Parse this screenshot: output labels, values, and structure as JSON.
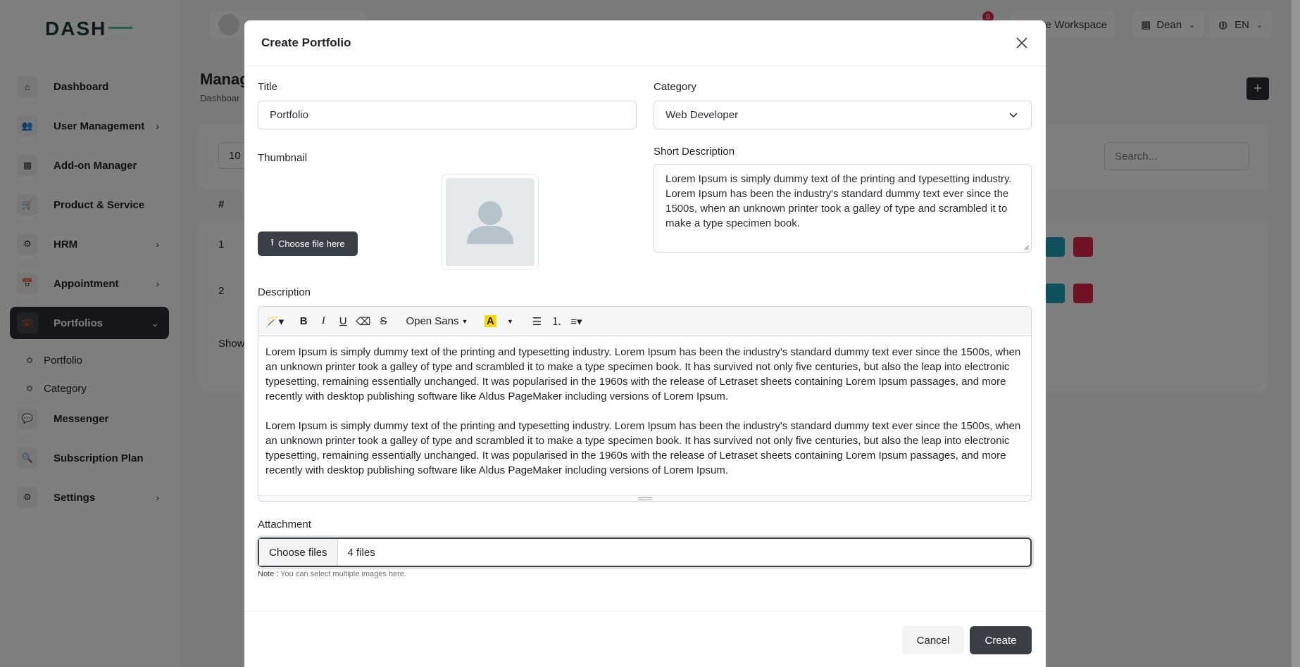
{
  "app": {
    "logo_text": "DASH",
    "topbar": {
      "notification_count": "0",
      "workspace_label": "Create Workspace",
      "user_name": "Dean",
      "language": "EN"
    },
    "sidebar": {
      "items": [
        {
          "label": "Dashboard",
          "icon": "home-icon"
        },
        {
          "label": "User Management",
          "icon": "users-icon",
          "has_children": true
        },
        {
          "label": "Add-on Manager",
          "icon": "grid-icon"
        },
        {
          "label": "Product & Service",
          "icon": "cart-icon"
        },
        {
          "label": "HRM",
          "icon": "hrm-icon",
          "has_children": true
        },
        {
          "label": "Appointment",
          "icon": "calendar-icon",
          "has_children": true
        },
        {
          "label": "Portfolios",
          "icon": "briefcase-icon",
          "has_children": true,
          "active": true
        },
        {
          "label": "Messenger",
          "icon": "chat-icon"
        },
        {
          "label": "Subscription Plan",
          "icon": "plan-icon"
        },
        {
          "label": "Settings",
          "icon": "gear-icon",
          "has_children": true
        }
      ],
      "portfolio_sub": [
        "Portfolio",
        "Category"
      ]
    },
    "page": {
      "title": "Manag",
      "breadcrumb": "Dashboar",
      "per_page": "10",
      "search_placeholder": "Search...",
      "table_header_index": "#",
      "rows": [
        "1",
        "2"
      ],
      "showing": "Show"
    }
  },
  "modal": {
    "title": "Create Portfolio",
    "title_label": "Title",
    "title_value": "Portfolio",
    "category_label": "Category",
    "category_value": "Web Developer",
    "thumbnail_label": "Thumbnail",
    "choose_file_label": "Choose file here",
    "short_desc_label": "Short Description",
    "short_desc_value": "Lorem Ipsum is simply dummy text of the printing and typesetting industry. Lorem Ipsum has been the industry's standard dummy text ever since the 1500s, when an unknown printer took a galley of type and scrambled it to make a type specimen book.",
    "description_label": "Description",
    "editor_font": "Open Sans",
    "description_paragraph": "Lorem Ipsum is simply dummy text of the printing and typesetting industry. Lorem Ipsum has been the industry's standard dummy text ever since the 1500s, when an unknown printer took a galley of type and scrambled it to make a type specimen book. It has survived not only five centuries, but also the leap into electronic typesetting, remaining essentially unchanged. It was popularised in the 1960s with the release of Letraset sheets containing Lorem Ipsum passages, and more recently with desktop publishing software like Aldus PageMaker including versions of Lorem Ipsum.",
    "attachment_label": "Attachment",
    "choose_files_label": "Choose files",
    "files_count": "4 files",
    "note_prefix": "Note :",
    "note_text": "You can select multiple images here.",
    "cancel_label": "Cancel",
    "create_label": "Create"
  },
  "colors": {
    "primary": "#3a3e45",
    "edit_button": "#1fa3b8",
    "delete_button": "#e0264b",
    "notification": "#e0264b"
  }
}
